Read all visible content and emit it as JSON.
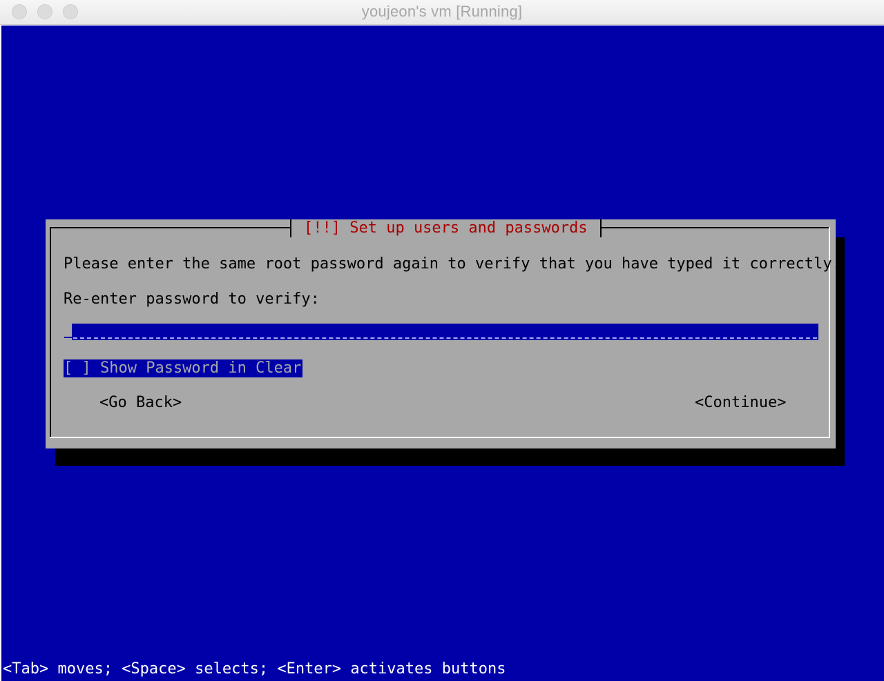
{
  "window": {
    "title": "youjeon's vm [Running]"
  },
  "dialog": {
    "title": "[!!] Set up users and passwords",
    "prompt": "Please enter the same root password again to verify that you have typed it correctly.",
    "field_label": "Re-enter password to verify:",
    "password_value": "",
    "checkbox": {
      "text": "[ ] Show Password in Clear",
      "checked": false
    },
    "buttons": {
      "back": "<Go Back>",
      "continue": "<Continue>"
    }
  },
  "help_line": "<Tab> moves; <Space> selects; <Enter> activates buttons",
  "colors": {
    "screen_background": "#0000a8",
    "dialog_background": "#a8a8a8",
    "dialog_title": "#a80000",
    "shadow": "#000000"
  }
}
